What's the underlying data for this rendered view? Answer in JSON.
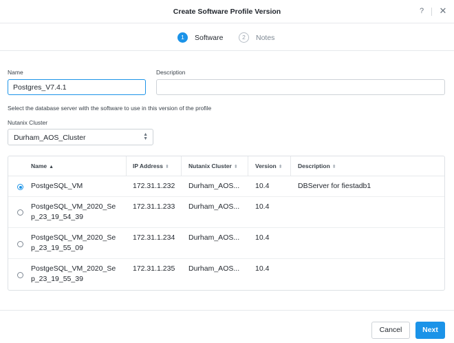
{
  "dialog": {
    "title": "Create Software Profile Version",
    "help": "?",
    "close": "✕"
  },
  "steps": [
    {
      "num": "1",
      "label": "Software"
    },
    {
      "num": "2",
      "label": "Notes"
    }
  ],
  "form": {
    "name_label": "Name",
    "name_value": "Postgres_V7.4.1",
    "description_label": "Description",
    "description_value": "",
    "hint": "Select the database server with the software to use in this version of the profile",
    "cluster_label": "Nutanix Cluster",
    "cluster_value": "Durham_AOS_Cluster"
  },
  "table": {
    "columns": [
      "Name",
      "IP Address",
      "Nutanix Cluster",
      "Version",
      "Description"
    ],
    "rows": [
      {
        "name1": "PostgeSQL_VM",
        "name2": "",
        "ip": "172.31.1.232",
        "cluster": "Durham_AOS...",
        "version": "10.4",
        "description": "DBServer for fiestadb1",
        "selected": true
      },
      {
        "name1": "PostgeSQL_VM_2020_Se",
        "name2": "p_23_19_54_39",
        "ip": "172.31.1.233",
        "cluster": "Durham_AOS...",
        "version": "10.4",
        "description": "",
        "selected": false
      },
      {
        "name1": "PostgeSQL_VM_2020_Se",
        "name2": "p_23_19_55_09",
        "ip": "172.31.1.234",
        "cluster": "Durham_AOS...",
        "version": "10.4",
        "description": "",
        "selected": false
      },
      {
        "name1": "PostgeSQL_VM_2020_Se",
        "name2": "p_23_19_55_39",
        "ip": "172.31.1.235",
        "cluster": "Durham_AOS...",
        "version": "10.4",
        "description": "",
        "selected": false
      }
    ]
  },
  "footer": {
    "cancel": "Cancel",
    "next": "Next"
  },
  "colors": {
    "accent": "#1b93e8"
  }
}
